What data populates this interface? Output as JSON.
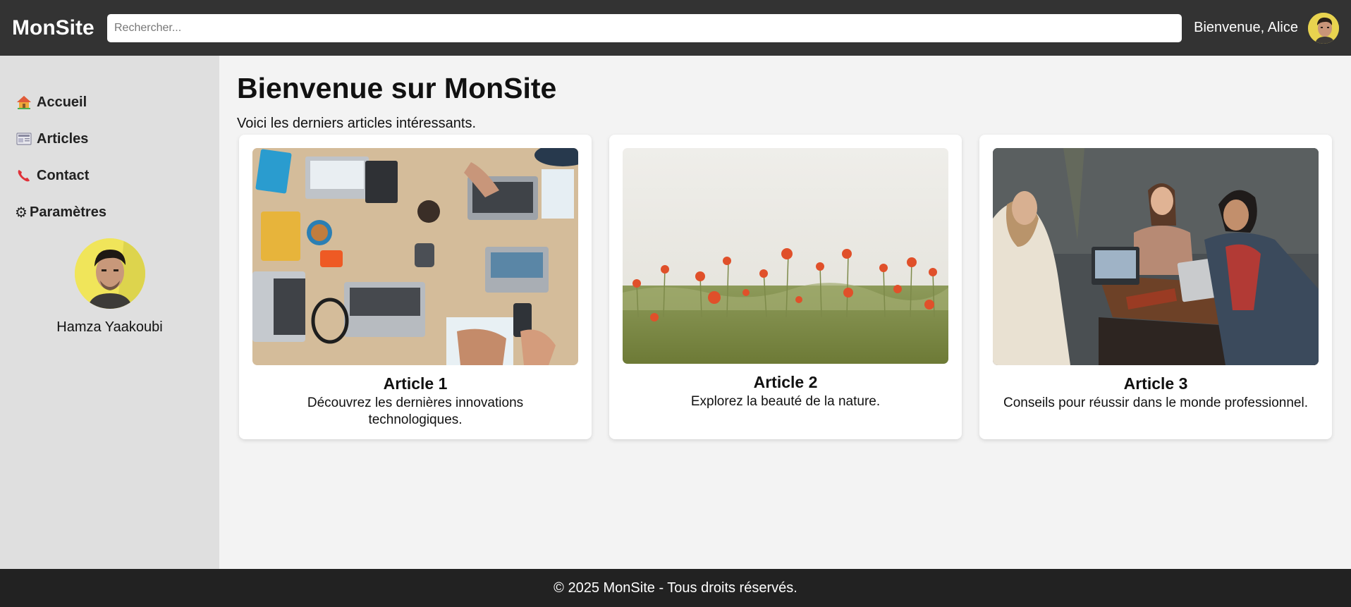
{
  "header": {
    "logo": "MonSite",
    "search_placeholder": "Rechercher...",
    "greeting": "Bienvenue, Alice"
  },
  "sidebar": {
    "items": [
      {
        "label": "Accueil",
        "icon": "house-icon"
      },
      {
        "label": "Articles",
        "icon": "newspaper-icon"
      },
      {
        "label": "Contact",
        "icon": "phone-icon"
      },
      {
        "label": "Paramètres",
        "icon": "gear-icon"
      }
    ],
    "profile": {
      "name": "Hamza Yaakoubi"
    }
  },
  "main": {
    "title": "Bienvenue sur MonSite",
    "subtitle": "Voici les derniers articles intéressants.",
    "articles": [
      {
        "title": "Article 1",
        "description": "Découvrez les dernières innovations technologiques.",
        "image": "desk-workspace-photo"
      },
      {
        "title": "Article 2",
        "description": "Explorez la beauté de la nature.",
        "image": "poppy-field-photo"
      },
      {
        "title": "Article 3",
        "description": "Conseils pour réussir dans le monde professionnel.",
        "image": "team-meeting-photo"
      }
    ]
  },
  "footer": {
    "text": "© 2025 MonSite - Tous droits réservés."
  },
  "colors": {
    "header_bg": "#333333",
    "sidebar_bg": "#dfdfdf",
    "main_bg": "#f3f3f3",
    "footer_bg": "#222222",
    "avatar_bg": "#f0e55a"
  }
}
